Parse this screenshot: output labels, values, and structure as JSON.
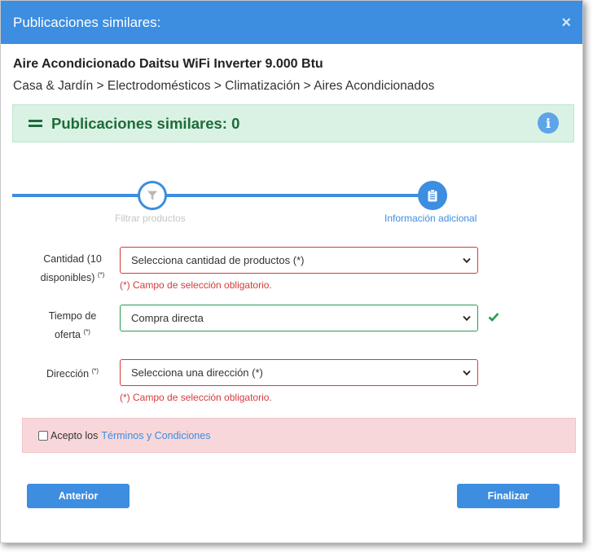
{
  "header": {
    "title": "Publicaciones similares:",
    "close_label": "×"
  },
  "product": {
    "name": "Aire Acondicionado Daitsu WiFi Inverter 9.000 Btu",
    "breadcrumb": "Casa & Jardín > Electrodomésticos > Climatización > Aires Acondicionados"
  },
  "similar": {
    "text": "Publicaciones similares: 0",
    "info_glyph": "i"
  },
  "stepper": {
    "steps": [
      {
        "label": "Filtrar productos",
        "icon": "filter-icon",
        "state": "inactive"
      },
      {
        "label": "Información adicional",
        "icon": "clipboard-icon",
        "state": "active"
      }
    ]
  },
  "form": {
    "quantity": {
      "label_line1": "Cantidad (10",
      "label_line2": "disponibles)",
      "required_mark": "(*)",
      "value": "Selecciona cantidad de productos (*)",
      "error": "(*) Campo de selección obligatorio."
    },
    "offer_time": {
      "label_line1": "Tiempo de",
      "label_line2": "oferta",
      "required_mark": "(*)",
      "value": "Compra directa"
    },
    "address": {
      "label": "Dirección",
      "required_mark": "(*)",
      "value": "Selecciona una dirección (*)",
      "error": "(*) Campo de selección obligatorio."
    }
  },
  "terms": {
    "prefix": "Acepto los",
    "link": "Términos y Condiciones"
  },
  "buttons": {
    "prev": "Anterior",
    "finish": "Finalizar"
  },
  "colors": {
    "primary": "#3d8de0",
    "success_bg": "#d9f2e3",
    "success_text": "#1f6b3a",
    "error": "#d63a3a",
    "valid": "#2a9a4e",
    "terms_bg": "#f8d7da"
  }
}
